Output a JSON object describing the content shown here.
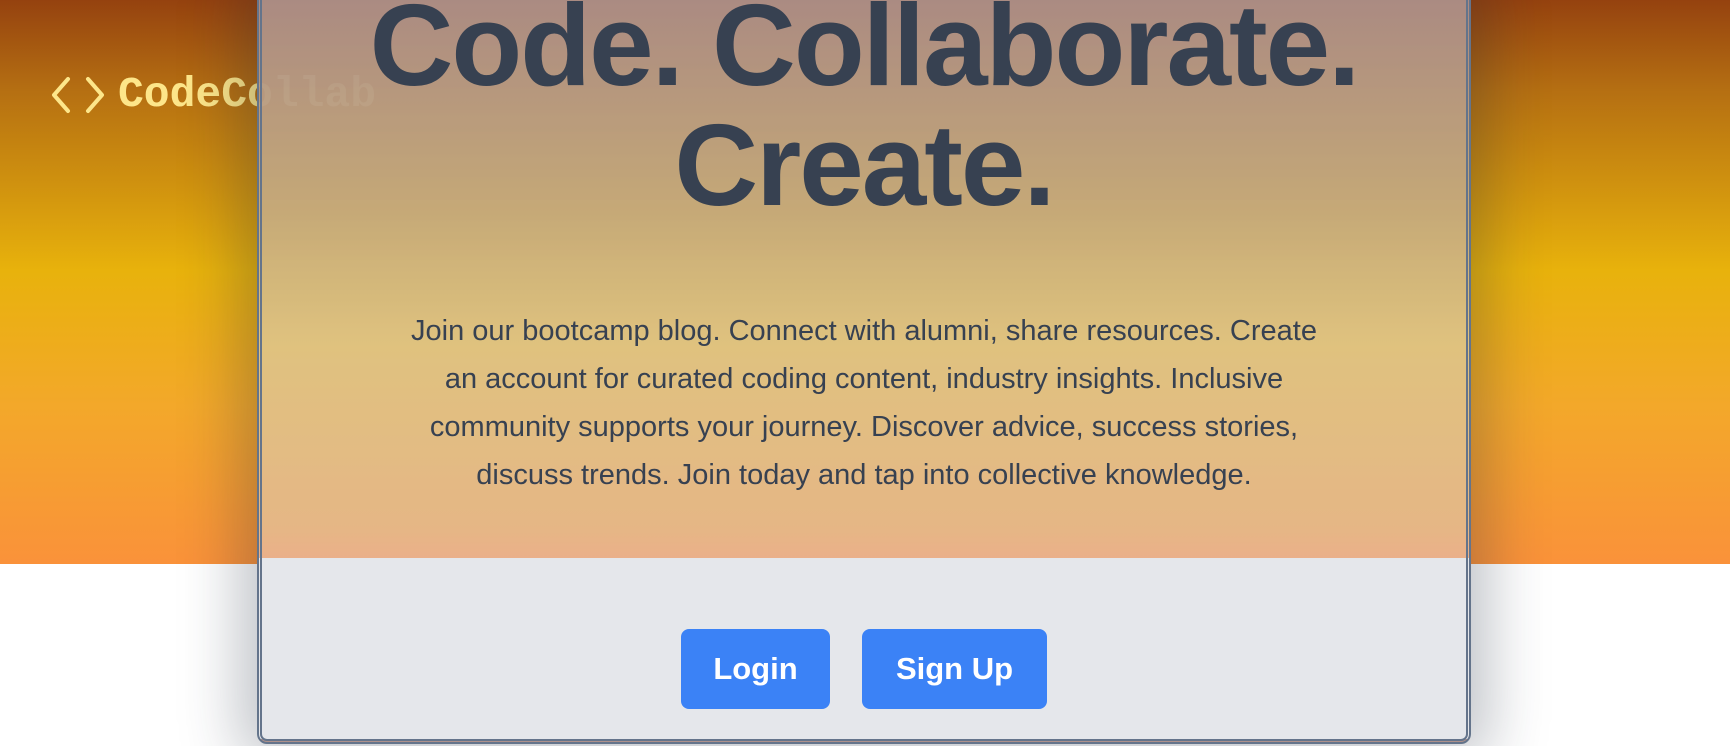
{
  "brand": {
    "logo_icon": "code-brackets-icon",
    "name": "CodeCollab",
    "color": "#fde68a"
  },
  "hero": {
    "headline_line1": "Code. Collaborate.",
    "headline_line2": "Create.",
    "description": "Join our bootcamp blog. Connect with alumni, share resources. Create an account for curated coding content, industry insights. Inclusive community supports your journey. Discover advice, success stories, discuss trends. Join today and tap into collective knowledge."
  },
  "actions": {
    "login_label": "Login",
    "signup_label": "Sign Up",
    "button_color": "#3b82f6"
  },
  "colors": {
    "heading_text": "#374151",
    "card_border": "#64748b",
    "card_footer_bg": "#e5e7eb",
    "gradient_top": "#95420f",
    "gradient_mid": "#e8b20c",
    "gradient_bottom": "#fa923a"
  }
}
